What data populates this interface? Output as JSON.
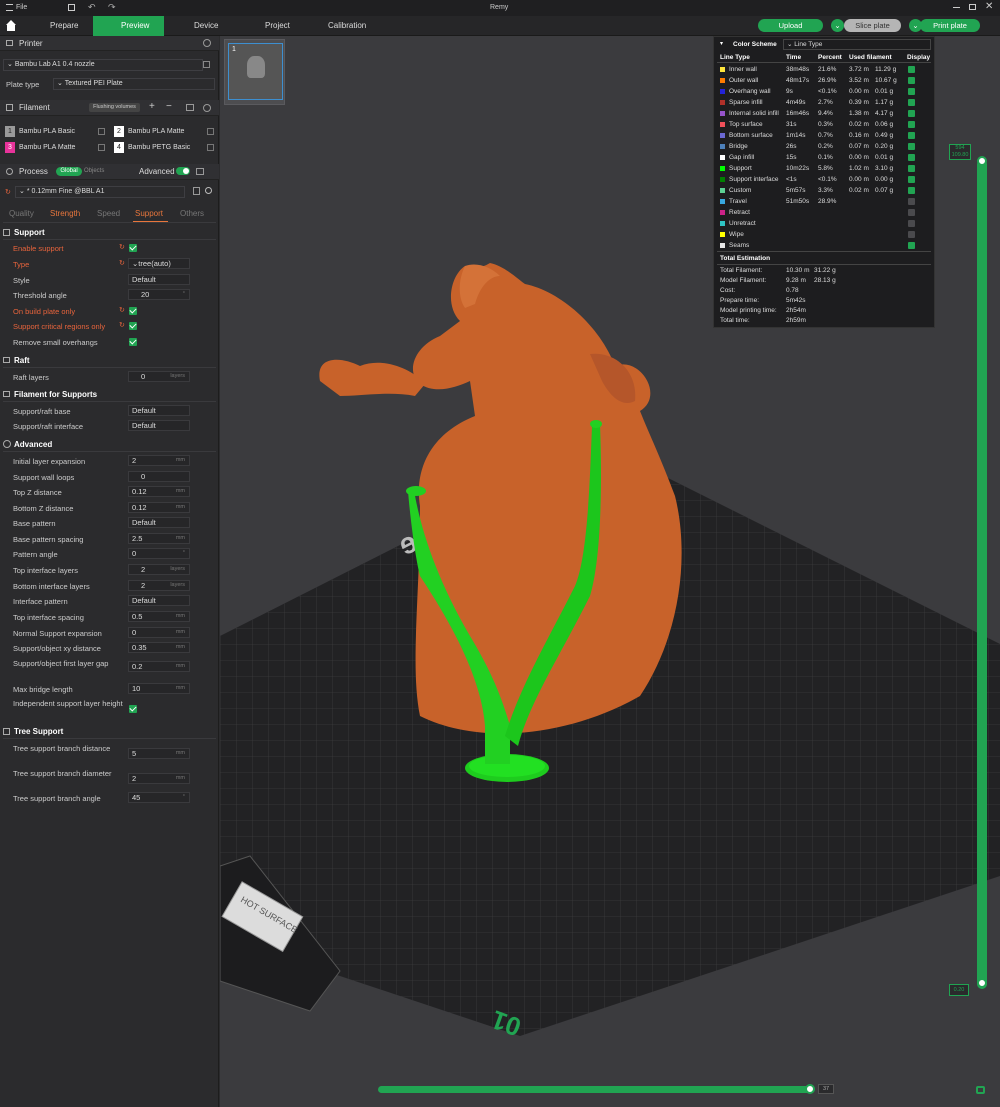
{
  "window": {
    "title": "Remy",
    "file_menu": "File"
  },
  "tabs": {
    "prepare": "Prepare",
    "preview": "Preview",
    "device": "Device",
    "project": "Project",
    "calibration": "Calibration"
  },
  "actions": {
    "upload": "Upload",
    "slice": "Slice plate",
    "print": "Print plate"
  },
  "printer": {
    "section": "Printer",
    "name": "Bambu Lab A1 0.4 nozzle",
    "plate_type_label": "Plate type",
    "plate_type": "Textured PEI Plate"
  },
  "filament": {
    "section": "Filament",
    "flushing": "Flushing volumes",
    "slots": [
      {
        "num": "1",
        "name": "Bambu PLA Basic",
        "color": "#9a9a9a"
      },
      {
        "num": "2",
        "name": "Bambu PLA Matte",
        "color": "#ffffff"
      },
      {
        "num": "3",
        "name": "Bambu PLA Matte",
        "color": "#e8339a"
      },
      {
        "num": "4",
        "name": "Bambu PETG Basic",
        "color": "#ffffff"
      }
    ]
  },
  "process": {
    "section": "Process",
    "global": "Global",
    "objects": "Objects",
    "advanced": "Advanced",
    "preset": "* 0.12mm Fine @BBL A1",
    "subtabs": [
      "Quality",
      "Strength",
      "Speed",
      "Support",
      "Others"
    ]
  },
  "support": {
    "group": "Support",
    "enable_support": "Enable support",
    "type_label": "Type",
    "type_value": "tree(auto)",
    "style_label": "Style",
    "style_value": "Default",
    "threshold_label": "Threshold angle",
    "threshold_value": "20",
    "threshold_unit": "°",
    "on_build_plate": "On build plate only",
    "critical_regions": "Support critical regions only",
    "remove_small": "Remove small overhangs"
  },
  "raft": {
    "group": "Raft",
    "layers_label": "Raft layers",
    "layers_value": "0",
    "layers_unit": "layers"
  },
  "filament_supports": {
    "group": "Filament for Supports",
    "base_label": "Support/raft base",
    "base_value": "Default",
    "interface_label": "Support/raft interface",
    "interface_value": "Default"
  },
  "advanced": {
    "group": "Advanced",
    "rows": [
      {
        "label": "Initial layer expansion",
        "value": "2",
        "unit": "mm"
      },
      {
        "label": "Support wall loops",
        "value": "0",
        "unit": ""
      },
      {
        "label": "Top Z distance",
        "value": "0.12",
        "unit": "mm"
      },
      {
        "label": "Bottom Z distance",
        "value": "0.12",
        "unit": "mm"
      },
      {
        "label": "Base pattern",
        "value": "Default",
        "unit": ""
      },
      {
        "label": "Base pattern spacing",
        "value": "2.5",
        "unit": "mm"
      },
      {
        "label": "Pattern angle",
        "value": "0",
        "unit": "°"
      },
      {
        "label": "Top interface layers",
        "value": "2",
        "unit": "layers"
      },
      {
        "label": "Bottom interface layers",
        "value": "2",
        "unit": "layers"
      },
      {
        "label": "Interface pattern",
        "value": "Default",
        "unit": ""
      },
      {
        "label": "Top interface spacing",
        "value": "0.5",
        "unit": "mm"
      },
      {
        "label": "Normal Support expansion",
        "value": "0",
        "unit": "mm"
      },
      {
        "label": "Support/object xy distance",
        "value": "0.35",
        "unit": "mm"
      },
      {
        "label": "Support/object first layer gap",
        "value": "0.2",
        "unit": "mm"
      },
      {
        "label": "Max bridge length",
        "value": "10",
        "unit": "mm"
      }
    ],
    "independent_label": "Independent support layer height"
  },
  "tree_support": {
    "group": "Tree Support",
    "rows": [
      {
        "label": "Tree support branch distance",
        "value": "5",
        "unit": "mm"
      },
      {
        "label": "Tree support branch diameter",
        "value": "2",
        "unit": "mm"
      },
      {
        "label": "Tree support branch angle",
        "value": "45",
        "unit": "°"
      }
    ]
  },
  "viewport": {
    "plate_number": "1",
    "plate_text": "Textured PEI Plate",
    "hot_surface": "HOT SURFACE",
    "plate_id": "01",
    "layer_top": "594\n109.80",
    "layer_top_a": "594",
    "layer_top_b": "109.80",
    "layer_bottom": "0.20",
    "horiz_value": "37"
  },
  "legend": {
    "title": "Color Scheme",
    "scheme": "Line Type",
    "headers": {
      "type": "Line Type",
      "time": "Time",
      "percent": "Percent",
      "used": "Used filament",
      "display": "Display"
    },
    "rows": [
      {
        "name": "Inner wall",
        "color": "#ffe63c",
        "time": "38m48s",
        "pct": "21.6%",
        "m": "3.72 m",
        "g": "11.29 g",
        "on": true
      },
      {
        "name": "Outer wall",
        "color": "#ff7b00",
        "time": "48m17s",
        "pct": "26.9%",
        "m": "3.52 m",
        "g": "10.67 g",
        "on": true
      },
      {
        "name": "Overhang wall",
        "color": "#2323d8",
        "time": "9s",
        "pct": "<0.1%",
        "m": "0.00 m",
        "g": "0.01 g",
        "on": true
      },
      {
        "name": "Sparse infill",
        "color": "#b03029",
        "time": "4m49s",
        "pct": "2.7%",
        "m": "0.39 m",
        "g": "1.17 g",
        "on": true
      },
      {
        "name": "Internal solid infill",
        "color": "#9654cc",
        "time": "16m46s",
        "pct": "9.4%",
        "m": "1.38 m",
        "g": "4.17 g",
        "on": true
      },
      {
        "name": "Top surface",
        "color": "#f0505a",
        "time": "31s",
        "pct": "0.3%",
        "m": "0.02 m",
        "g": "0.06 g",
        "on": true
      },
      {
        "name": "Bottom surface",
        "color": "#6b68d3",
        "time": "1m14s",
        "pct": "0.7%",
        "m": "0.16 m",
        "g": "0.49 g",
        "on": true
      },
      {
        "name": "Bridge",
        "color": "#4d80ba",
        "time": "26s",
        "pct": "0.2%",
        "m": "0.07 m",
        "g": "0.20 g",
        "on": true
      },
      {
        "name": "Gap infill",
        "color": "#ffffff",
        "time": "15s",
        "pct": "0.1%",
        "m": "0.00 m",
        "g": "0.01 g",
        "on": true
      },
      {
        "name": "Support",
        "color": "#00ff00",
        "time": "10m22s",
        "pct": "5.8%",
        "m": "1.02 m",
        "g": "3.10 g",
        "on": true
      },
      {
        "name": "Support interface",
        "color": "#008000",
        "time": "<1s",
        "pct": "<0.1%",
        "m": "0.00 m",
        "g": "0.00 g",
        "on": true
      },
      {
        "name": "Custom",
        "color": "#5ed194",
        "time": "5m57s",
        "pct": "3.3%",
        "m": "0.02 m",
        "g": "0.07 g",
        "on": true
      },
      {
        "name": "Travel",
        "color": "#38a8e0",
        "time": "51m50s",
        "pct": "28.9%",
        "m": "",
        "g": "",
        "on": false
      },
      {
        "name": "Retract",
        "color": "#cc2288",
        "time": "",
        "pct": "",
        "m": "",
        "g": "",
        "on": false
      },
      {
        "name": "Unretract",
        "color": "#2ec4c4",
        "time": "",
        "pct": "",
        "m": "",
        "g": "",
        "on": false
      },
      {
        "name": "Wipe",
        "color": "#ffff00",
        "time": "",
        "pct": "",
        "m": "",
        "g": "",
        "on": false
      },
      {
        "name": "Seams",
        "color": "#e6e6e6",
        "time": "",
        "pct": "",
        "m": "",
        "g": "",
        "on": true
      }
    ],
    "total_title": "Total Estimation",
    "totals": [
      {
        "label": "Total Filament:",
        "a": "10.30 m",
        "b": "31.22 g"
      },
      {
        "label": "Model Filament:",
        "a": "9.28 m",
        "b": "28.13 g"
      },
      {
        "label": "Cost:",
        "a": "0.78",
        "b": ""
      },
      {
        "label": "Prepare time:",
        "a": "5m42s",
        "b": ""
      },
      {
        "label": "Model printing time:",
        "a": "2h54m",
        "b": ""
      },
      {
        "label": "Total time:",
        "a": "2h59m",
        "b": ""
      }
    ]
  },
  "colors": {
    "accent": "#21a452",
    "highlight": "#e8643c",
    "model": "#c8622a",
    "support": "#22d022"
  }
}
